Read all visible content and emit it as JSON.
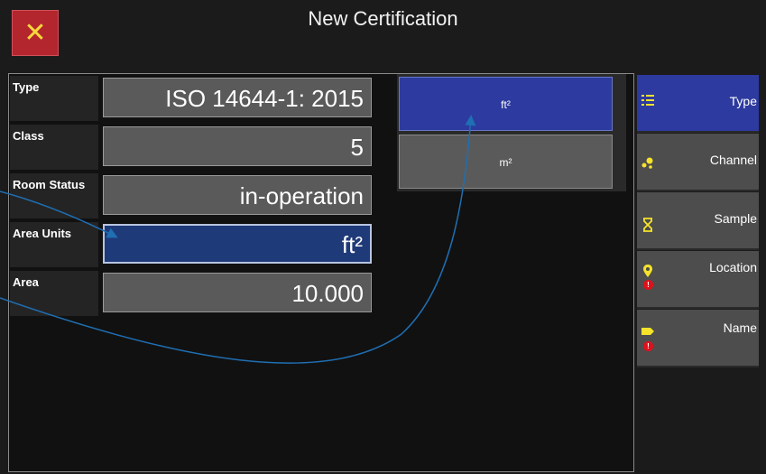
{
  "header": {
    "title": "New Certification",
    "close_symbol": "✕"
  },
  "form": {
    "rows": [
      {
        "label": "Type",
        "value": "ISO 14644-1: 2015"
      },
      {
        "label": "Class",
        "value": "5"
      },
      {
        "label": "Room Status",
        "value": "in-operation"
      },
      {
        "label": "Area Units",
        "value": "ft²"
      },
      {
        "label": "Area",
        "value": "10.000"
      }
    ]
  },
  "unit_options": [
    "ft²",
    "m²"
  ],
  "selected_unit": "ft²",
  "nav": {
    "items": [
      {
        "label": "Type",
        "icon": "list-icon",
        "alert": false
      },
      {
        "label": "Channel",
        "icon": "channel-icon",
        "alert": false
      },
      {
        "label": "Sample",
        "icon": "hourglass-icon",
        "alert": false
      },
      {
        "label": "Location",
        "icon": "location-pin-icon",
        "alert": true
      },
      {
        "label": "Name",
        "icon": "tag-icon",
        "alert": true
      }
    ]
  },
  "colors": {
    "close_bg": "#b3262e",
    "close_x": "#f6d83a",
    "selected_blue": "#2d3a9f",
    "active_field": "#1f3a78",
    "icon_yellow": "#f6e32a",
    "alert_red": "#e0101a",
    "annotation_arrow": "#1f6fb3"
  }
}
